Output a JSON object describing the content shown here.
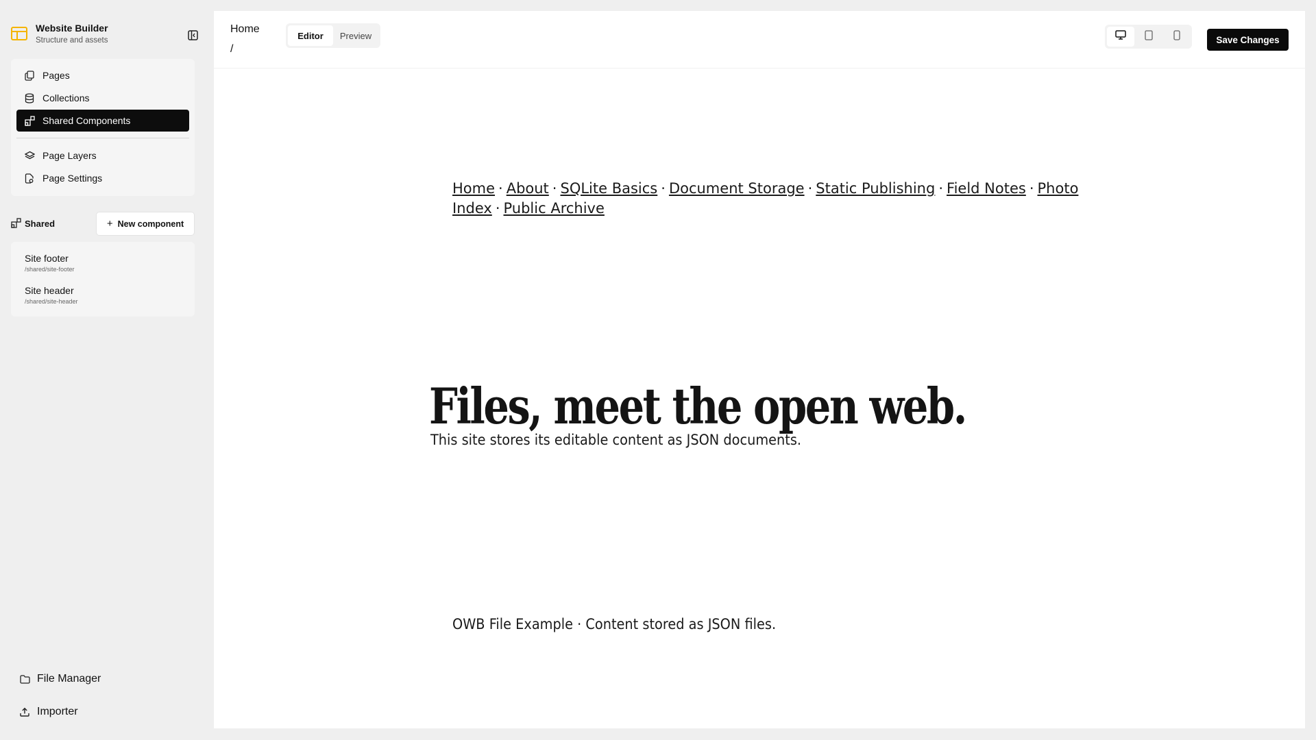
{
  "sidebar": {
    "brand": {
      "title": "Website Builder",
      "subtitle": "Structure and assets",
      "accent": "#f5b400"
    },
    "nav_primary": [
      {
        "label": "Pages",
        "icon": "pages-icon"
      },
      {
        "label": "Collections",
        "icon": "database-icon"
      },
      {
        "label": "Shared Components",
        "icon": "shared-components-icon",
        "active": true
      }
    ],
    "nav_secondary": [
      {
        "label": "Page Layers",
        "icon": "layers-icon"
      },
      {
        "label": "Page Settings",
        "icon": "page-settings-icon"
      }
    ],
    "shared": {
      "heading": "Shared",
      "new_button": "New component",
      "items": [
        {
          "name": "Site footer",
          "path": "/shared/site-footer"
        },
        {
          "name": "Site header",
          "path": "/shared/site-header"
        }
      ]
    },
    "bottom": [
      {
        "label": "File Manager",
        "icon": "folder-icon"
      },
      {
        "label": "Importer",
        "icon": "upload-icon"
      }
    ]
  },
  "topbar": {
    "breadcrumb": {
      "page": "Home",
      "path": "/"
    },
    "tabs": [
      {
        "label": "Editor",
        "active": true
      },
      {
        "label": "Preview",
        "active": false
      }
    ],
    "devices": [
      "desktop-icon",
      "tablet-icon",
      "mobile-icon"
    ],
    "active_device": "desktop-icon",
    "save_label": "Save Changes"
  },
  "canvas": {
    "nav_links": [
      "Home",
      "About",
      "SQLite Basics",
      "Document Storage",
      "Static Publishing",
      "Field Notes",
      "Photo Index",
      "Public Archive"
    ],
    "separator": "·",
    "hero_title": "Files, meet the open web.",
    "hero_subtitle": "This site stores its editable content as JSON documents.",
    "footer_text": "OWB File Example · Content stored as JSON files."
  }
}
